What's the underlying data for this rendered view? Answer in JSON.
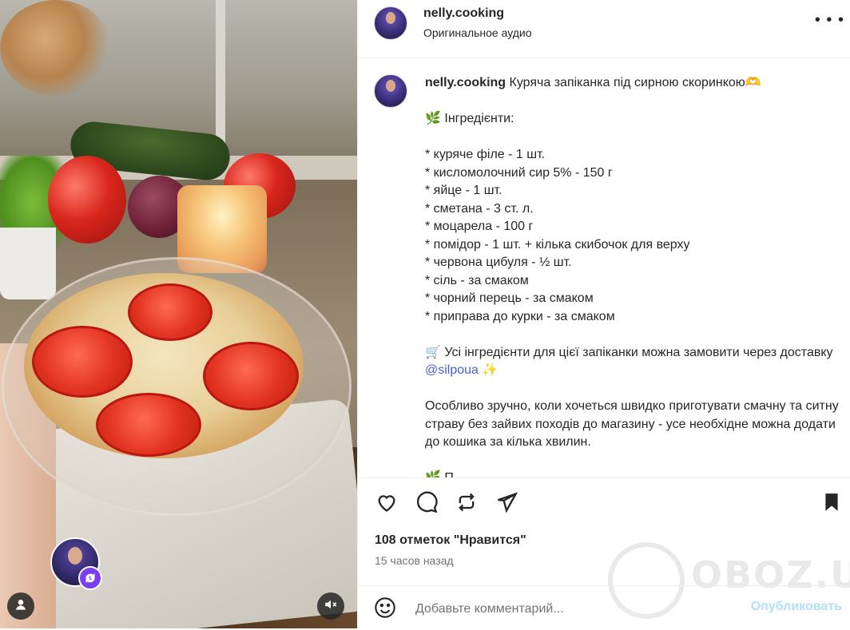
{
  "post": {
    "username": "nelly.cooking",
    "audio": "Оригинальное аудио",
    "more_icon": "more-dots-icon"
  },
  "caption": {
    "username": "nelly.cooking",
    "title": "Куряча запіканка під сирною скоринкою🫶",
    "ingredients_header": "🌿 Інгредієнти:",
    "ingredients": [
      "* куряче філе - 1 шт.",
      "* кисломолочний сир 5% - 150 г",
      "* яйце - 1 шт.",
      "* сметана - 3 ст. л.",
      "* моцарела - 100 г",
      "* помідор - 1 шт. + кілька скибочок для верху",
      "* червона цибуля - ½ шт.",
      "* сіль - за смаком",
      "* чорний перець - за смаком",
      "* приправа до курки - за смаком"
    ],
    "order_text": "🛒 Усі інгредієнти для цієї запіканки можна замовити через доставку ",
    "mention": "@silpoua",
    "order_suffix": " ✨",
    "paragraph": "Особливо зручно, коли хочеться швидко приготувати смачну та ситну страву без зайвих походів до магазину - усе необхідне можна додати до кошика за кілька хвилин.",
    "cut_line": "🌿 П"
  },
  "actions": {
    "like_icon": "heart-icon",
    "comment_icon": "comment-icon",
    "repost_icon": "repost-icon",
    "share_icon": "send-icon",
    "save_icon": "bookmark-icon"
  },
  "likes_text": "108 отметок \"Нравится\"",
  "time_text": "15 часов назад",
  "comment": {
    "placeholder": "Добавьте комментарий...",
    "post_label": "Опубликовать"
  },
  "watermark": "OBOZ.UA",
  "colors": {
    "link": "#4a5fd6",
    "post_button_disabled": "#b2dffc",
    "secondary_text": "#737373",
    "remix_badge": "#7b3ff0"
  }
}
